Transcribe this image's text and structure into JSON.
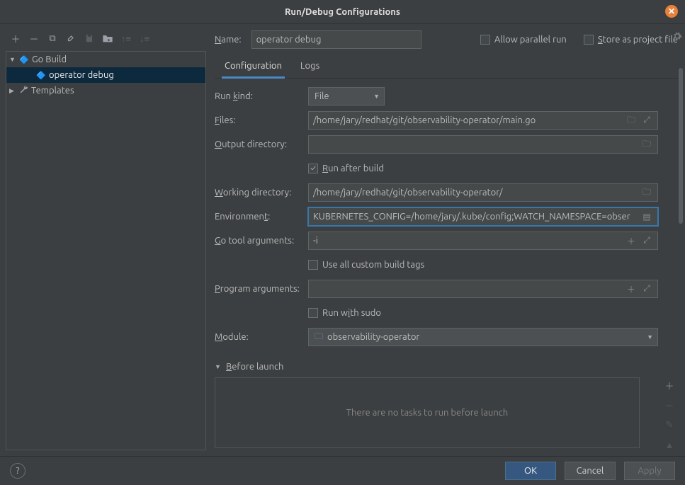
{
  "window": {
    "title": "Run/Debug Configurations"
  },
  "toolbar_icons": {
    "add": "＋",
    "remove": "－",
    "copy": "⧉",
    "wrench": "🔧",
    "save": "💾",
    "folder_move": "📂",
    "up": "↑",
    "down": "↓"
  },
  "tree": {
    "root_label": "Go Build",
    "selected_label": "operator debug",
    "templates_label": "Templates"
  },
  "header": {
    "name_label": "Name:",
    "name_value": "operator debug",
    "allow_parallel_label": "Allow parallel run",
    "store_label": "Store as project file"
  },
  "tabs": {
    "config": "Configuration",
    "logs": "Logs"
  },
  "form": {
    "run_kind_label": "Run kind:",
    "run_kind_value": "File",
    "files_label": "Files:",
    "files_value": "/home/jary/redhat/git/observability-operator/main.go",
    "output_dir_label": "Output directory:",
    "output_dir_value": "",
    "run_after_build_label": "Run after build",
    "working_dir_label": "Working directory:",
    "working_dir_value": "/home/jary/redhat/git/observability-operator/",
    "environment_label": "Environment:",
    "environment_value": "KUBERNETES_CONFIG=/home/jary/.kube/config;WATCH_NAMESPACE=obser",
    "go_tool_args_label": "Go tool arguments:",
    "go_tool_args_value": "-i",
    "use_custom_tags_label": "Use all custom build tags",
    "program_args_label": "Program arguments:",
    "program_args_value": "",
    "run_with_sudo_label": "Run with sudo",
    "module_label": "Module:",
    "module_value": "observability-operator"
  },
  "before_launch": {
    "header": "Before launch",
    "empty_text": "There are no tasks to run before launch"
  },
  "footer": {
    "ok": "OK",
    "cancel": "Cancel",
    "apply": "Apply",
    "help": "?"
  }
}
